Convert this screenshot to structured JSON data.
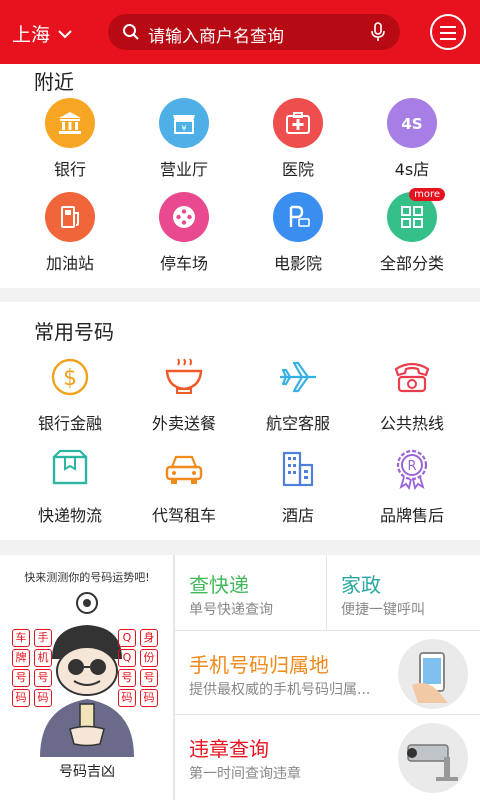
{
  "header": {
    "city": "上海",
    "search_placeholder": "请输入商户名查询"
  },
  "nearby": {
    "title": "附近",
    "items": [
      {
        "label": "银行",
        "icon": "bank-icon",
        "color": "#f6a623"
      },
      {
        "label": "营业厅",
        "icon": "store-icon",
        "color": "#4fb0e8"
      },
      {
        "label": "医院",
        "icon": "first-aid-icon",
        "color": "#ef4e4e"
      },
      {
        "label": "4s店",
        "icon": "car-dealer-icon",
        "color": "#a77de6"
      },
      {
        "label": "加油站",
        "icon": "fuel-icon",
        "color": "#f0663a"
      },
      {
        "label": "停车场",
        "icon": "parking-wheel-icon",
        "color": "#e94a8f"
      },
      {
        "label": "电影院",
        "icon": "parking-bus-icon",
        "color": "#3a8ef0"
      },
      {
        "label": "全部分类",
        "icon": "grid-icon",
        "color": "#35c08a",
        "badge": "more"
      }
    ]
  },
  "common": {
    "title": "常用号码",
    "items": [
      {
        "label": "银行金融",
        "icon": "dollar-icon",
        "color": "#f0a21f"
      },
      {
        "label": "外卖送餐",
        "icon": "bowl-icon",
        "color": "#f05a28"
      },
      {
        "label": "航空客服",
        "icon": "airplane-icon",
        "color": "#37b0e6"
      },
      {
        "label": "公共热线",
        "icon": "phone-icon",
        "color": "#ec3b4a"
      },
      {
        "label": "快递物流",
        "icon": "package-icon",
        "color": "#2bb6a0"
      },
      {
        "label": "代驾租车",
        "icon": "car-icon",
        "color": "#f08a1a"
      },
      {
        "label": "酒店",
        "icon": "building-icon",
        "color": "#4f7fd8"
      },
      {
        "label": "品牌售后",
        "icon": "ribbon-icon",
        "color": "#9a63d8"
      }
    ]
  },
  "promo": {
    "top_text": "快来测测你的号码运势吧!",
    "bottom_text": "号码吉凶",
    "left_chars": [
      "手",
      "机",
      "号",
      "码"
    ],
    "left_chars2": [
      "车",
      "牌",
      "号",
      "码"
    ],
    "right_chars": [
      "身",
      "份",
      "号",
      "码"
    ],
    "right_chars2": [
      "Q",
      "Q",
      "号",
      "码"
    ]
  },
  "cards": {
    "express": {
      "title": "查快递",
      "subtitle": "单号快递查询",
      "color": "#42b85a"
    },
    "housekeeping": {
      "title": "家政",
      "subtitle": "便捷一键呼叫",
      "color": "#2aa8a0"
    },
    "phone_location": {
      "title": "手机号码归属地",
      "subtitle": "提供最权威的手机号码归属...",
      "color": "#f08a1a"
    },
    "violation": {
      "title": "违章查询",
      "subtitle": "第一时间查询违章",
      "color": "#e8121f"
    }
  }
}
